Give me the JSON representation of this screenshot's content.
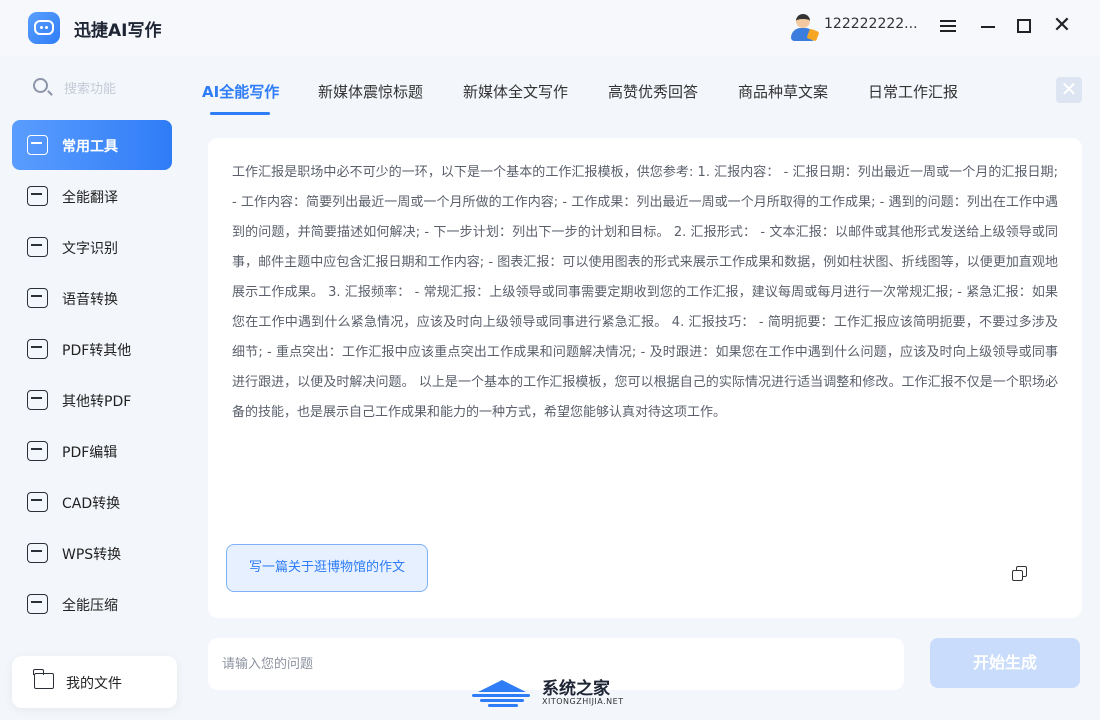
{
  "app": {
    "title": "迅捷AI写作"
  },
  "user": {
    "name": "122222222..."
  },
  "sidebar": {
    "search_placeholder": "搜索功能",
    "items": [
      {
        "label": "常用工具",
        "active": true
      },
      {
        "label": "全能翻译"
      },
      {
        "label": "文字识别"
      },
      {
        "label": "语音转换"
      },
      {
        "label": "PDF转其他"
      },
      {
        "label": "其他转PDF"
      },
      {
        "label": "PDF编辑"
      },
      {
        "label": "CAD转换"
      },
      {
        "label": "WPS转换"
      },
      {
        "label": "全能压缩"
      }
    ],
    "my_files": "我的文件"
  },
  "tabs": [
    {
      "label": "AI全能写作",
      "active": true
    },
    {
      "label": "新媒体震惊标题"
    },
    {
      "label": "新媒体全文写作"
    },
    {
      "label": "高赞优秀回答"
    },
    {
      "label": "商品种草文案"
    },
    {
      "label": "日常工作汇报"
    }
  ],
  "content": {
    "text": "工作汇报是职场中必不可少的一环，以下是一个基本的工作汇报模板，供您参考: 1. 汇报内容：  - 汇报日期：列出最近一周或一个月的汇报日期; - 工作内容：简要列出最近一周或一个月所做的工作内容; - 工作成果：列出最近一周或一个月所取得的工作成果; - 遇到的问题：列出在工作中遇到的问题，并简要描述如何解决; - 下一步计划：列出下一步的计划和目标。 2. 汇报形式：  - 文本汇报：以邮件或其他形式发送给上级领导或同事，邮件主题中应包含汇报日期和工作内容; - 图表汇报：可以使用图表的形式来展示工作成果和数据，例如柱状图、折线图等，以便更加直观地展示工作成果。 3. 汇报频率：  - 常规汇报：上级领导或同事需要定期收到您的工作汇报，建议每周或每月进行一次常规汇报; - 紧急汇报：如果您在工作中遇到什么紧急情况，应该及时向上级领导或同事进行紧急汇报。 4. 汇报技巧：  - 简明扼要：工作汇报应该简明扼要，不要过多涉及细节; - 重点突出：工作汇报中应该重点突出工作成果和问题解决情况; - 及时跟进：如果您在工作中遇到什么问题，应该及时向上级领导或同事进行跟进，以便及时解决问题。 以上是一个基本的工作汇报模板，您可以根据自己的实际情况进行适当调整和修改。工作汇报不仅是一个职场必备的技能，也是展示自己工作成果和能力的一种方式，希望您能够认真对待这项工作。",
    "suggestion": "写一篇关于逛博物馆的作文"
  },
  "input": {
    "placeholder": "请输入您的问题",
    "value": ""
  },
  "generate_label": "开始生成",
  "watermark": {
    "title": "系统之家",
    "subtitle": "XITONGZHIJIA.NET"
  },
  "colors": {
    "accent": "#2e7cf6",
    "generate_disabled": "#c9dcfb"
  }
}
